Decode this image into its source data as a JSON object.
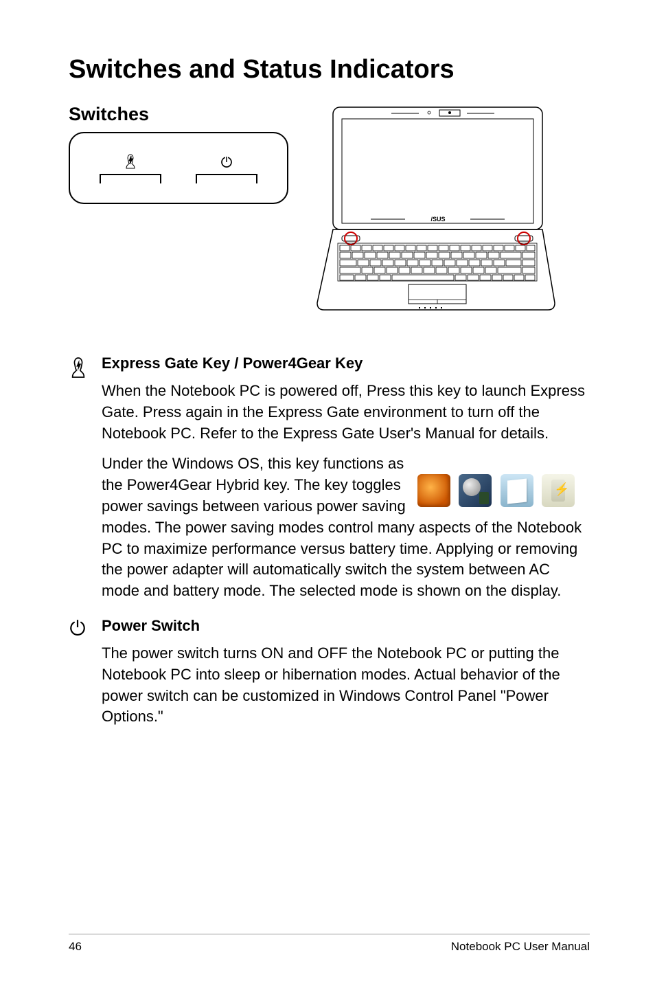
{
  "heading": "Switches and Status Indicators",
  "section": {
    "title": "Switches"
  },
  "features": [
    {
      "title": "Express Gate Key / Power4Gear Key",
      "para1": "When the Notebook PC is powered off, Press this key to launch Express Gate. Press again in the Express Gate environment to turn off the Notebook PC. Refer to the Express Gate User's Manual for details.",
      "para2": "Under the Windows OS, this key functions as the Power4Gear Hybrid key. The key toggles power savings between various power saving modes. The power saving modes control many aspects of the Notebook PC to maximize performance versus battery time. Applying or removing the power adapter will automatically switch the system between AC mode and battery mode. The selected mode is shown on the display."
    },
    {
      "title": "Power Switch",
      "para1": "The power switch turns ON and OFF the Notebook PC or putting the Notebook PC into sleep or hibernation modes. Actual behavior of the power switch can be customized in Windows Control Panel \"Power Options.\""
    }
  ],
  "footer": {
    "page": "46",
    "label": "Notebook PC User Manual"
  }
}
